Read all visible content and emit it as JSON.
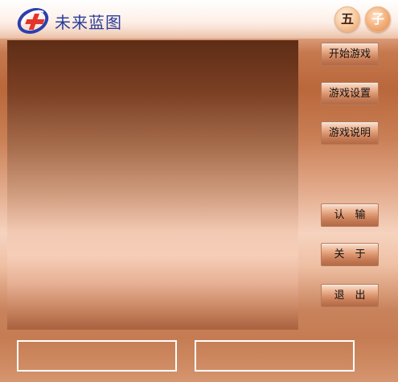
{
  "header": {
    "brand_name": "未来蓝图",
    "logo_icon": "future-blueprint-logo",
    "badges": [
      "五",
      "子"
    ]
  },
  "menu": {
    "start_game": "开始游戏",
    "game_settings": "游戏设置",
    "game_help": "游戏说明",
    "resign": "认输",
    "about": "关于",
    "exit": "退出"
  },
  "colors": {
    "brand_text": "#2b3c9c",
    "logo_blue": "#2c3fae",
    "logo_red": "#e2352a"
  }
}
